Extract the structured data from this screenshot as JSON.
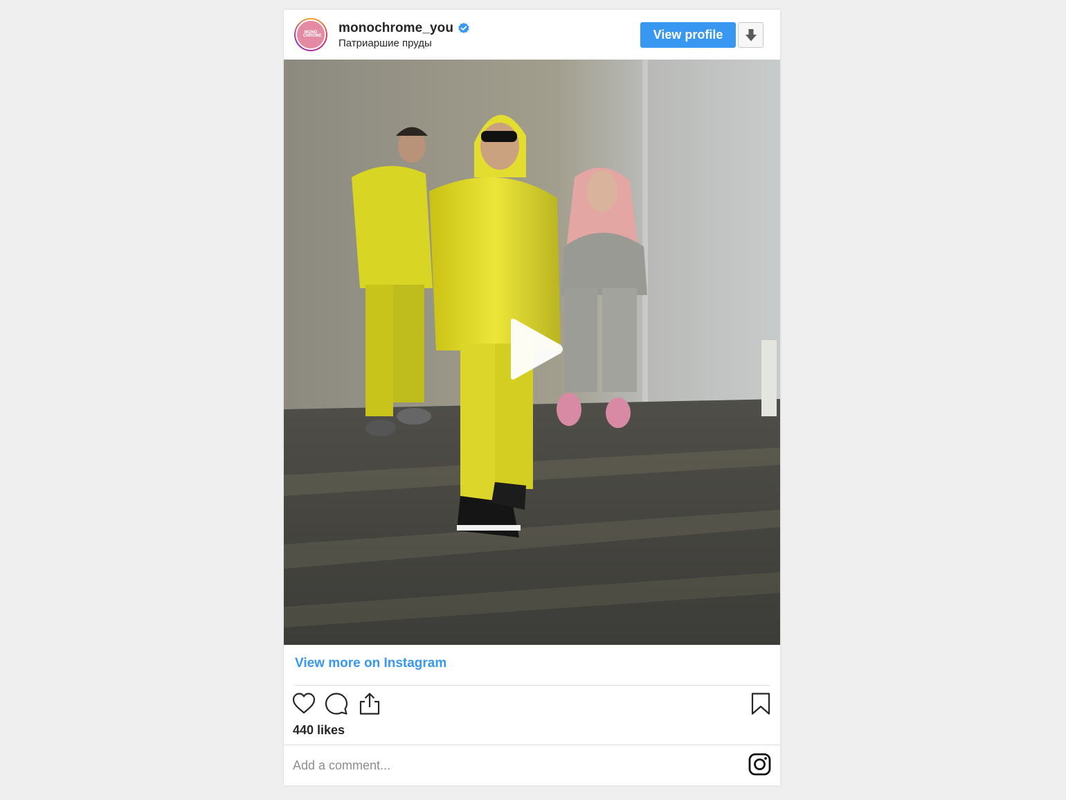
{
  "post": {
    "username": "monochrome_you",
    "verified": true,
    "location": "Патриаршие пруды",
    "avatar_mark": "MONO CHROME",
    "view_profile_label": "View profile",
    "download_icon": "download-arrow-icon",
    "media_type": "video",
    "play_icon": "play-icon",
    "view_more_label": "View more on Instagram",
    "likes_text": "440 likes",
    "comment_placeholder": "Add a comment...",
    "action_icons": [
      "heart-icon",
      "comment-icon",
      "share-icon",
      "bookmark-icon"
    ]
  },
  "colors": {
    "accent_blue": "#3897f0",
    "text_dark": "#262626",
    "placeholder_gray": "#8e8e8e",
    "divider": "#dbdbdb",
    "page_background": "#efefef"
  }
}
